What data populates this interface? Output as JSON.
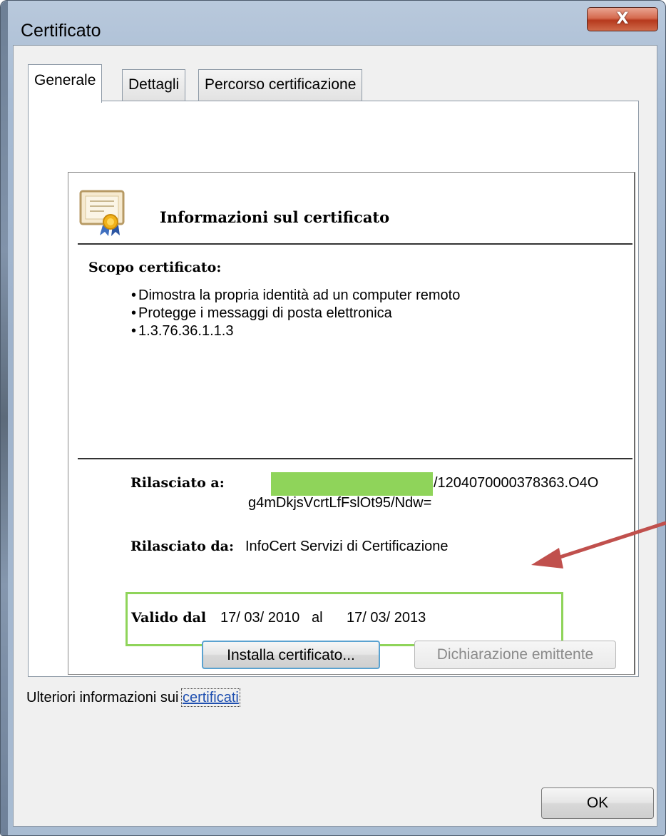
{
  "window": {
    "title": "Certificato",
    "close_symbol": "X"
  },
  "tabs": [
    {
      "label": "Generale",
      "active": true
    },
    {
      "label": "Dettagli",
      "active": false
    },
    {
      "label": "Percorso certificazione",
      "active": false
    }
  ],
  "info": {
    "heading": "Informazioni sul certificato",
    "icon": "certificate-icon",
    "scope_label": "Scopo certificato:",
    "purposes": [
      "Dimostra la propria identità ad un computer remoto",
      "Protegge i messaggi di posta elettronica",
      "1.3.76.36.1.1.3"
    ],
    "issued_to_label": "Rilasciato a:",
    "issued_to_line1": "/1204070000378363.O4O",
    "issued_to_line2": "g4mDkjsVcrtLfFslOt95/Ndw=",
    "issued_by_label": "Rilasciato da:",
    "issued_by_value": "InfoCert Servizi di Certificazione",
    "valid_label": "Valido dal",
    "valid_from": "17/ 03/ 2010",
    "valid_al": "al",
    "valid_to": "17/ 03/ 2013"
  },
  "buttons": {
    "install": "Installa certificato...",
    "issuer_statement": "Dichiarazione emittente",
    "ok": "OK"
  },
  "more_info": {
    "prefix": "Ulteriori informazioni sui",
    "link": "certificati"
  },
  "colors": {
    "highlight": "#8fd45a",
    "arrow": "#c0504d",
    "link": "#1e4fb0"
  }
}
